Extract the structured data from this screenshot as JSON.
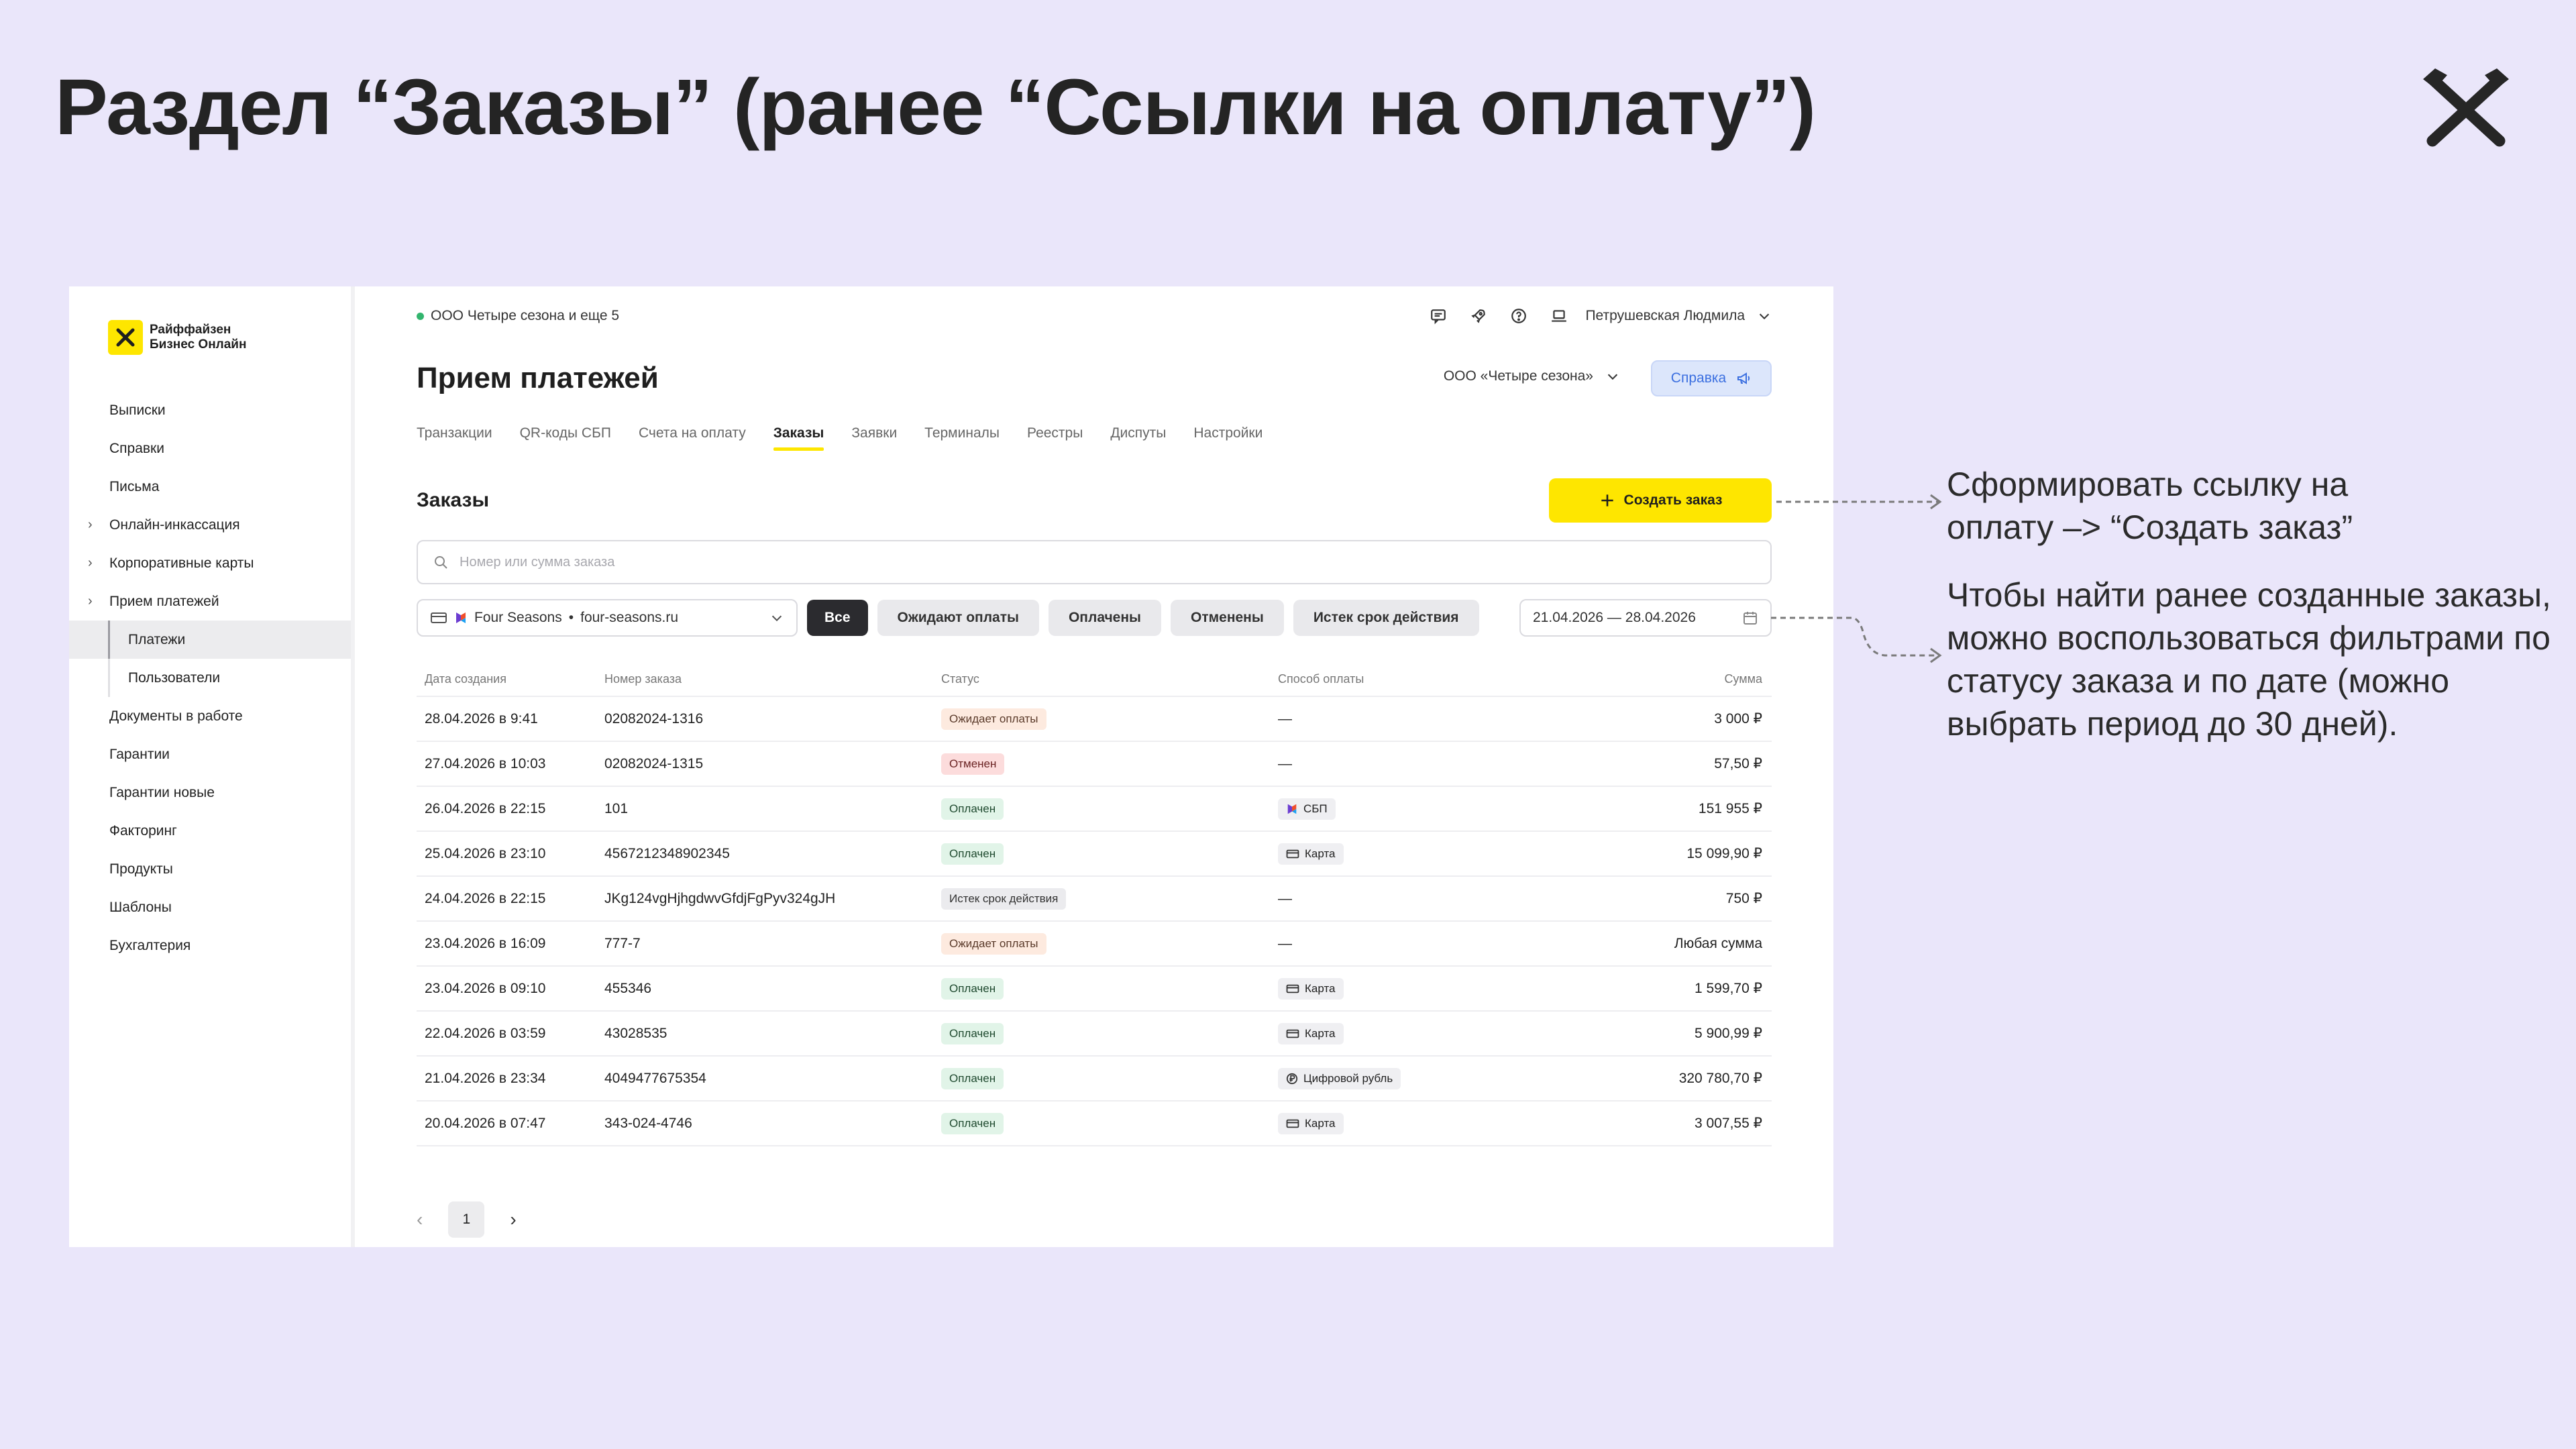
{
  "slide": {
    "title": "Раздел “Заказы” (ранее “Ссылки на оплату”)"
  },
  "sidebar": {
    "logo_line1": "Райффайзен",
    "logo_line2": "Бизнес Онлайн",
    "items": [
      {
        "label": "Выписки"
      },
      {
        "label": "Справки"
      },
      {
        "label": "Письма"
      },
      {
        "label": "Онлайн-инкассация"
      },
      {
        "label": "Корпоративные карты"
      },
      {
        "label": "Прием платежей"
      },
      {
        "label": "Платежи"
      },
      {
        "label": "Пользователи"
      },
      {
        "label": "Документы в работе"
      },
      {
        "label": "Гарантии"
      },
      {
        "label": "Гарантии новые"
      },
      {
        "label": "Факторинг"
      },
      {
        "label": "Продукты"
      },
      {
        "label": "Шаблоны"
      },
      {
        "label": "Бухгалтерия"
      }
    ]
  },
  "topbar": {
    "org": "ООО Четыре сезона и еще 5",
    "user": "Петрушевская Людмила"
  },
  "page": {
    "title": "Прием платежей",
    "company": "ООО «Четыре сезона»",
    "help": "Справка"
  },
  "tabs": [
    {
      "label": "Транзакции"
    },
    {
      "label": "QR-коды СБП"
    },
    {
      "label": "Счета на оплату"
    },
    {
      "label": "Заказы"
    },
    {
      "label": "Заявки"
    },
    {
      "label": "Терминалы"
    },
    {
      "label": "Реестры"
    },
    {
      "label": "Диспуты"
    },
    {
      "label": "Настройки"
    }
  ],
  "orders": {
    "section_title": "Заказы",
    "create_label": "Создать заказ",
    "search_placeholder": "Номер или сумма заказа",
    "shop_name": "Four Seasons",
    "shop_sep": "•",
    "shop_site": "four-seasons.ru",
    "filters": [
      {
        "label": "Все"
      },
      {
        "label": "Ожидают оплаты"
      },
      {
        "label": "Оплачены"
      },
      {
        "label": "Отменены"
      },
      {
        "label": "Истек срок действия"
      }
    ],
    "date_range": "21.04.2026 — 28.04.2026",
    "columns": [
      "Дата создания",
      "Номер заказа",
      "Статус",
      "Способ оплаты",
      "Сумма"
    ],
    "rows": [
      {
        "date": "28.04.2026 в 9:41",
        "number": "02082024-1316",
        "status": "Ожидает оплаты",
        "method": "—",
        "amount": "3 000 ₽"
      },
      {
        "date": "27.04.2026 в 10:03",
        "number": "02082024-1315",
        "status": "Отменен",
        "method": "—",
        "amount": "57,50 ₽"
      },
      {
        "date": "26.04.2026 в 22:15",
        "number": "101",
        "status": "Оплачен",
        "method": "СБП",
        "amount": "151 955 ₽"
      },
      {
        "date": "25.04.2026 в 23:10",
        "number": "4567212348902345",
        "status": "Оплачен",
        "method": "Карта",
        "amount": "15 099,90 ₽"
      },
      {
        "date": "24.04.2026 в 22:15",
        "number": "JKg124vgHjhgdwvGfdjFgPyv324gJH",
        "status": "Истек срок действия",
        "method": "—",
        "amount": "750 ₽"
      },
      {
        "date": "23.04.2026 в 16:09",
        "number": "777-7",
        "status": "Ожидает оплаты",
        "method": "—",
        "amount": "Любая сумма"
      },
      {
        "date": "23.04.2026 в 09:10",
        "number": "455346",
        "status": "Оплачен",
        "method": "Карта",
        "amount": "1 599,70 ₽"
      },
      {
        "date": "22.04.2026 в 03:59",
        "number": "43028535",
        "status": "Оплачен",
        "method": "Карта",
        "amount": "5 900,99 ₽"
      },
      {
        "date": "21.04.2026 в 23:34",
        "number": "4049477675354",
        "status": "Оплачен",
        "method": "Цифровой рубль",
        "amount": "320 780,70 ₽"
      },
      {
        "date": "20.04.2026 в 07:47",
        "number": "343-024-4746",
        "status": "Оплачен",
        "method": "Карта",
        "amount": "3 007,55 ₽"
      }
    ],
    "page_number": "1"
  },
  "annotations": {
    "note1_line1": "Сформировать ссылку на",
    "note1_line2": "оплату –> “Создать заказ”",
    "note2_line1": "Чтобы найти ранее созданные заказы,",
    "note2_line2": "можно воспользоваться фильтрами по",
    "note2_line3": "статусу заказа и по дате (можно",
    "note2_line4": "выбрать период до 30 дней)."
  },
  "colors": {
    "background": "#EAE6FA",
    "accent_yellow": "#FEE600",
    "help_blue": "#3B6FE0",
    "status_pending": "#FDEADF",
    "status_cancel": "#FCDCDC",
    "status_paid": "#E1F4E8",
    "status_expired": "#EBEBEE"
  },
  "icons": [
    "raiffeisen-logo-icon",
    "chat-icon",
    "rocket-icon",
    "help-circle-icon",
    "laptop-icon",
    "chevron-down-icon",
    "megaphone-icon",
    "plus-icon",
    "search-icon",
    "card-icon",
    "sbp-icon",
    "digital-ruble-icon",
    "calendar-icon",
    "chevron-left-icon",
    "chevron-right-icon"
  ]
}
